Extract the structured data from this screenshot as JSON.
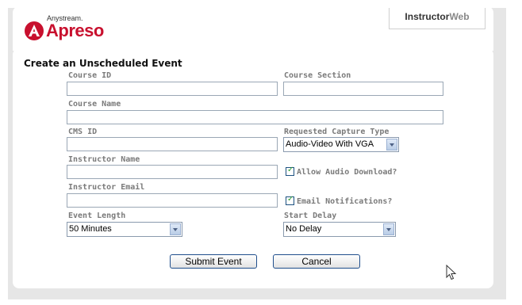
{
  "header": {
    "brand_top": "Anystream.",
    "brand_main": "Apreso",
    "instructor_prefix": "Instructor",
    "instructor_suffix": "Web"
  },
  "form": {
    "title": "Create an Unscheduled Event",
    "course_id_label": "Course ID",
    "course_id_value": "",
    "course_section_label": "Course Section",
    "course_section_value": "",
    "course_name_label": "Course Name",
    "course_name_value": "",
    "cms_id_label": "CMS ID",
    "cms_id_value": "",
    "capture_type_label": "Requested Capture Type",
    "capture_type_value": "Audio-Video With VGA",
    "instructor_name_label": "Instructor Name",
    "instructor_name_value": "",
    "allow_audio_label": "Allow Audio Download?",
    "allow_audio_checked": true,
    "instructor_email_label": "Instructor Email",
    "instructor_email_value": "",
    "email_notifications_label": "Email Notifications?",
    "email_notifications_checked": true,
    "event_length_label": "Event Length",
    "event_length_value": "50 Minutes",
    "start_delay_label": "Start Delay",
    "start_delay_value": "No Delay",
    "submit_label": "Submit Event",
    "cancel_label": "Cancel"
  },
  "colors": {
    "brand_red": "#c8102e",
    "label_gray": "#7a7a7a",
    "button_border": "#1f4e8c",
    "check_green": "#2c9f2c"
  }
}
